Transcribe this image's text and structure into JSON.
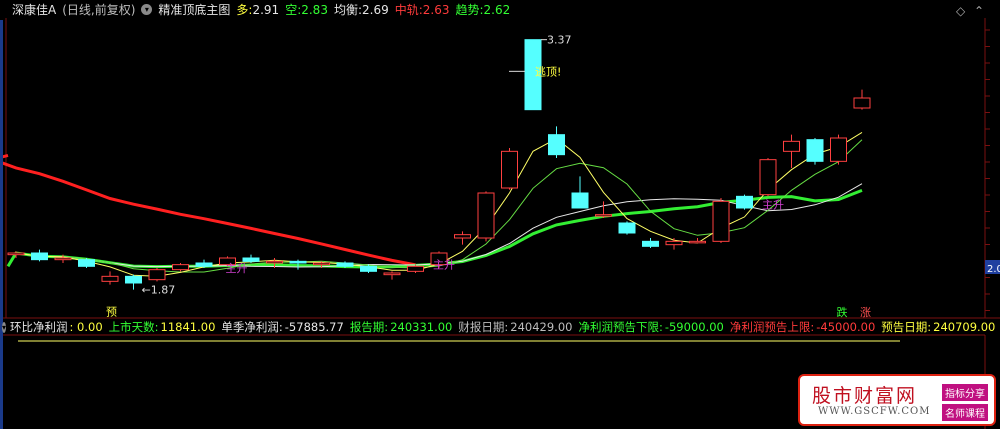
{
  "header": {
    "stock_name": "深康佳A",
    "period": "(日线,前复权)",
    "indicator_name": "精准顶底主图",
    "duo_label": "多:",
    "duo_value": "2.91",
    "kong_label": "空:",
    "kong_value": "2.83",
    "junheng_label": "均衡:",
    "junheng_value": "2.69",
    "zhonggui_label": "中轨:",
    "zhonggui_value": "2.63",
    "qushi_label": "趋势:",
    "qushi_value": "2.62"
  },
  "chart_annotations": {
    "high_price": "3.37",
    "low_price": "←1.87",
    "escape_top": "逃顶!",
    "start_rise": "主升",
    "pre_label": "预",
    "fall_label": "跌",
    "rise_label": "涨",
    "axis_value": "2.0"
  },
  "indicator_bar": {
    "title": "环比净利润",
    "title_value": ": 0.00",
    "ipo_days_label": "上市天数:",
    "ipo_days_value": "11841.00",
    "quarter_profit_label": "单季净利润:",
    "quarter_profit_value": "-57885.77",
    "report_period_label": "报告期:",
    "report_period_value": "240331.00",
    "report_date_label": "财报日期:",
    "report_date_value": "240429.00",
    "forecast_low_label": "净利润预告下限:",
    "forecast_low_value": "-59000.00",
    "forecast_high_label": "净利润预告上限:",
    "forecast_high_value": "-45000.00",
    "forecast_date_label": "预告日期:",
    "forecast_date_value": "240709.00"
  },
  "watermark": {
    "site_name": "股市财富网",
    "url": "WWW.GSCFW.COM",
    "tag1": "指标分享",
    "tag2": "名师课程"
  },
  "colors": {
    "up": "#ff4040",
    "down": "#55ffff",
    "ma_red": "#ff2020",
    "ma_green": "#33ee33",
    "ma_white": "#e8e8e8",
    "ma_yellow": "#ffff66",
    "ma_lightgreen": "#66dd44"
  },
  "chart_data": {
    "type": "candlestick",
    "candles": [
      {
        "o": 2.08,
        "h": 2.1,
        "l": 2.06,
        "c": 2.09
      },
      {
        "o": 2.09,
        "h": 2.11,
        "l": 2.04,
        "c": 2.05
      },
      {
        "o": 2.05,
        "h": 2.08,
        "l": 2.03,
        "c": 2.06
      },
      {
        "o": 2.05,
        "h": 2.06,
        "l": 2.0,
        "c": 2.01
      },
      {
        "o": 1.92,
        "h": 1.98,
        "l": 1.9,
        "c": 1.95
      },
      {
        "o": 1.95,
        "h": 1.96,
        "l": 1.87,
        "c": 1.91
      },
      {
        "o": 1.93,
        "h": 2.0,
        "l": 1.92,
        "c": 1.99
      },
      {
        "o": 1.99,
        "h": 2.03,
        "l": 1.98,
        "c": 2.02
      },
      {
        "o": 2.03,
        "h": 2.05,
        "l": 2.0,
        "c": 2.01
      },
      {
        "o": 2.02,
        "h": 2.07,
        "l": 2.01,
        "c": 2.06
      },
      {
        "o": 2.06,
        "h": 2.08,
        "l": 2.03,
        "c": 2.04
      },
      {
        "o": 2.03,
        "h": 2.06,
        "l": 2.0,
        "c": 2.04
      },
      {
        "o": 2.04,
        "h": 2.05,
        "l": 1.99,
        "c": 2.03
      },
      {
        "o": 2.02,
        "h": 2.04,
        "l": 2.0,
        "c": 2.03
      },
      {
        "o": 2.03,
        "h": 2.04,
        "l": 2.0,
        "c": 2.01
      },
      {
        "o": 2.01,
        "h": 2.02,
        "l": 1.97,
        "c": 1.98
      },
      {
        "o": 1.96,
        "h": 1.98,
        "l": 1.93,
        "c": 1.97
      },
      {
        "o": 1.98,
        "h": 2.02,
        "l": 1.97,
        "c": 2.01
      },
      {
        "o": 2.02,
        "h": 2.1,
        "l": 2.0,
        "c": 2.09
      },
      {
        "o": 2.18,
        "h": 2.22,
        "l": 2.14,
        "c": 2.2
      },
      {
        "o": 2.18,
        "h": 2.46,
        "l": 2.16,
        "c": 2.45
      },
      {
        "o": 2.48,
        "h": 2.72,
        "l": 2.47,
        "c": 2.7
      },
      {
        "o": 3.37,
        "h": 3.37,
        "l": 2.95,
        "c": 2.95
      },
      {
        "o": 2.8,
        "h": 2.85,
        "l": 2.66,
        "c": 2.68
      },
      {
        "o": 2.45,
        "h": 2.55,
        "l": 2.36,
        "c": 2.36
      },
      {
        "o": 2.32,
        "h": 2.4,
        "l": 2.3,
        "c": 2.32
      },
      {
        "o": 2.27,
        "h": 2.28,
        "l": 2.2,
        "c": 2.21
      },
      {
        "o": 2.16,
        "h": 2.18,
        "l": 2.12,
        "c": 2.13
      },
      {
        "o": 2.14,
        "h": 2.18,
        "l": 2.11,
        "c": 2.16
      },
      {
        "o": 2.16,
        "h": 2.18,
        "l": 2.15,
        "c": 2.16
      },
      {
        "o": 2.16,
        "h": 2.42,
        "l": 2.15,
        "c": 2.4
      },
      {
        "o": 2.43,
        "h": 2.44,
        "l": 2.35,
        "c": 2.36
      },
      {
        "o": 2.44,
        "h": 2.66,
        "l": 2.43,
        "c": 2.65
      },
      {
        "o": 2.7,
        "h": 2.8,
        "l": 2.6,
        "c": 2.76
      },
      {
        "o": 2.77,
        "h": 2.78,
        "l": 2.62,
        "c": 2.64
      },
      {
        "o": 2.64,
        "h": 2.8,
        "l": 2.62,
        "c": 2.78
      },
      {
        "o": 2.96,
        "h": 3.07,
        "l": 2.95,
        "c": 3.02
      }
    ],
    "ylim": [
      1.7,
      3.5
    ]
  }
}
